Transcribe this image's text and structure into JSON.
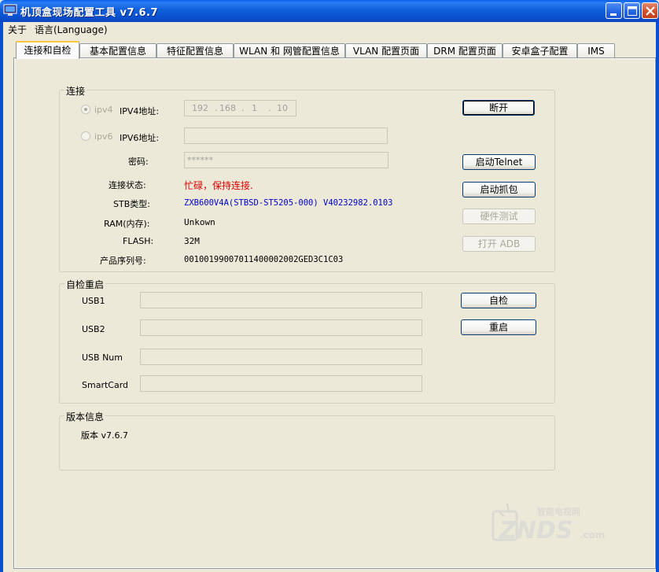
{
  "window": {
    "title": "机顶盒现场配置工具 v7.6.7"
  },
  "menu": {
    "about": "关于",
    "language": "语言(Language)"
  },
  "tabs": [
    {
      "label": "连接和自检"
    },
    {
      "label": "基本配置信息"
    },
    {
      "label": "特征配置信息"
    },
    {
      "label": "WLAN 和 网管配置信息"
    },
    {
      "label": "VLAN 配置页面"
    },
    {
      "label": "DRM 配置页面"
    },
    {
      "label": "安卓盒子配置"
    },
    {
      "label": "IMS"
    }
  ],
  "connection": {
    "group_title": "连接",
    "ipv4_radio": "ipv4",
    "ipv4_label": "IPV4地址:",
    "ipv4_octets": [
      "192",
      "168",
      "1",
      "10"
    ],
    "ipv6_radio": "ipv6",
    "ipv6_label": "IPV6地址:",
    "password_label": "密码:",
    "password_value": "******",
    "status_label": "连接状态:",
    "status_value": "忙碌，保持连接.",
    "stb_label": "STB类型:",
    "stb_value": "ZXB600V4A(STBSD-ST5205-000) V40232982.0103",
    "ram_label": "RAM(内存):",
    "ram_value": "Unkown",
    "flash_label": "FLASH:",
    "flash_value": "32M",
    "serial_label": "产品序列号:",
    "serial_value": "00100199007011400002002GED3C1C03",
    "buttons": {
      "disconnect": "断开",
      "telnet": "启动Telnet",
      "capture": "启动抓包",
      "hwtest": "硬件测试",
      "adb": "打开 ADB"
    },
    "colors": {
      "status": "#e00000",
      "stb": "#0000c8"
    }
  },
  "selftest": {
    "group_title": "自检重启",
    "usb1": "USB1",
    "usb2": "USB2",
    "usbnum": "USB Num",
    "smartcard": "SmartCard",
    "selftest_button": "自检",
    "reboot_button": "重启"
  },
  "version": {
    "group_title": "版本信息",
    "text": "版本 v7.6.7"
  },
  "watermark": {
    "top": "智能电视网",
    "brand": "ZNDS",
    "suffix": ".com"
  }
}
